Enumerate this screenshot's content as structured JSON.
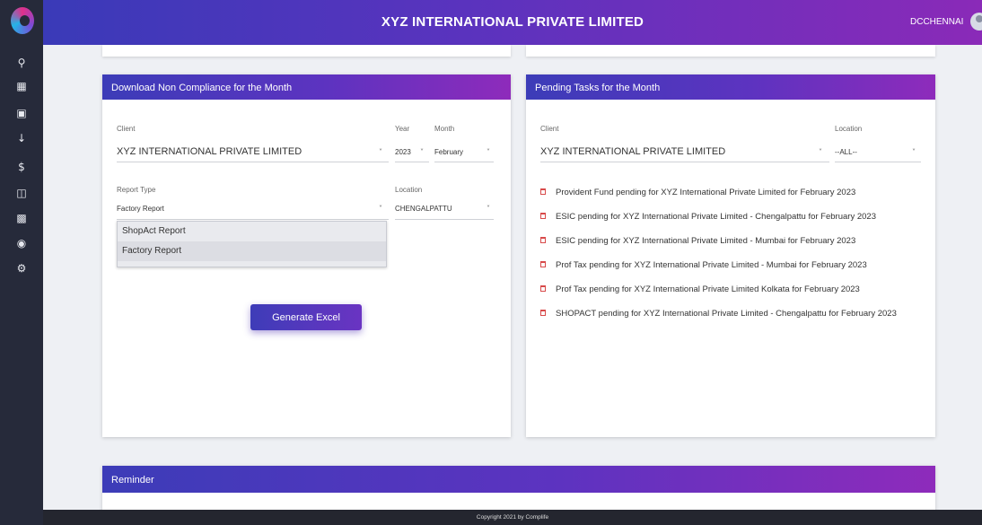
{
  "topbar": {
    "title": "XYZ INTERNATIONAL PRIVATE LIMITED",
    "user": "DCCHENNAI"
  },
  "sidebar": {
    "icons": [
      "logo-icon",
      "search-icon",
      "dashboard-icon",
      "calendar-icon",
      "download-icon",
      "dollar-icon",
      "report-icon",
      "document-icon",
      "account-icon",
      "settings-icon"
    ]
  },
  "download_card": {
    "title": "Download Non Compliance for the Month",
    "client_label": "Client",
    "client_value": "XYZ INTERNATIONAL PRIVATE LIMITED",
    "year_label": "Year",
    "year_value": "2023",
    "month_label": "Month",
    "month_value": "February",
    "report_type_label": "Report Type",
    "report_type_value": "Factory Report",
    "location_label": "Location",
    "location_value": "CHENGALPATTU",
    "options": [
      "ShopAct Report",
      "Factory Report"
    ],
    "button_label": "Generate Excel"
  },
  "pending_card": {
    "title": "Pending Tasks for the Month",
    "client_label": "Client",
    "client_value": "XYZ INTERNATIONAL PRIVATE LIMITED",
    "location_label": "Location",
    "location_value": "--ALL--",
    "tasks": [
      "Provident Fund pending for XYZ International Private Limited for February 2023",
      "ESIC pending for XYZ International Private Limited - Chengalpattu for February 2023",
      "ESIC pending for XYZ International Private Limited - Mumbai for February 2023",
      "Prof Tax pending for XYZ International Private Limited - Mumbai for February 2023",
      "Prof Tax pending for XYZ International Private Limited Kolkata for February 2023",
      "SHOPACT pending for XYZ International Private Limited - Chengalpattu for February 2023"
    ]
  },
  "reminder": {
    "title": "Reminder"
  },
  "footer": {
    "text": "Copyright 2021 by Complife"
  },
  "colors": {
    "accent_start": "#3c3cb8",
    "accent_end": "#8e2bbb",
    "sidebar": "#262a3a",
    "task_icon": "#d84a4a"
  }
}
